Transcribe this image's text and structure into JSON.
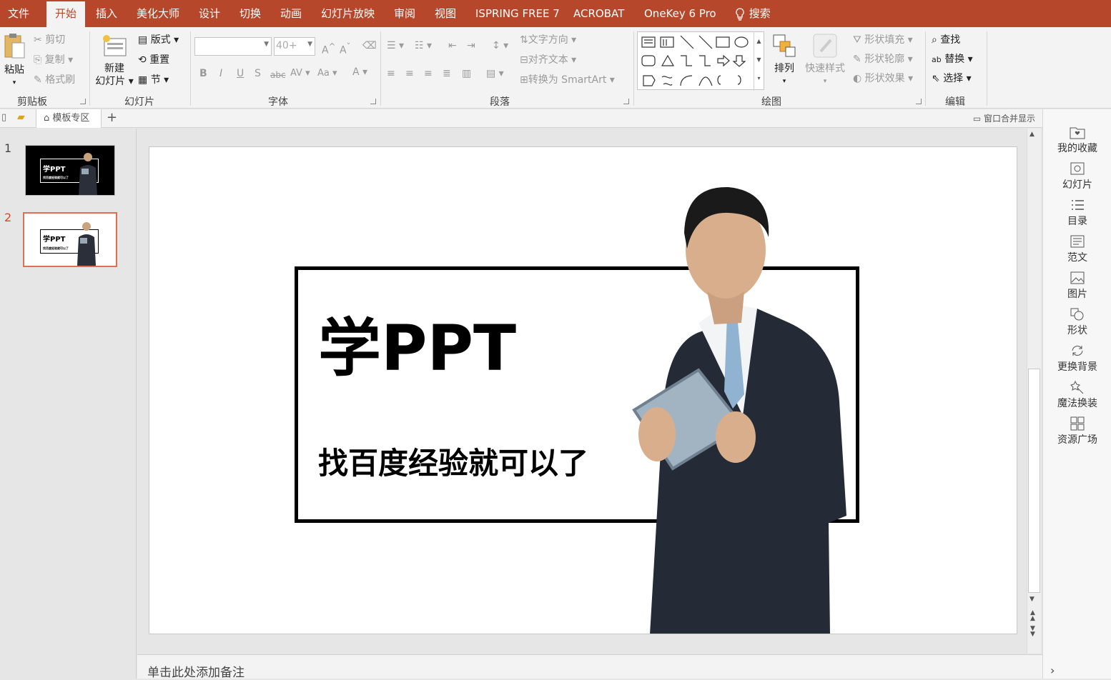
{
  "tabs": [
    "文件",
    "开始",
    "插入",
    "美化大师",
    "设计",
    "切换",
    "动画",
    "幻灯片放映",
    "审阅",
    "视图",
    "ISPRING FREE 7",
    "ACROBAT",
    "OneKey 6 Pro",
    "搜索"
  ],
  "clipboard": {
    "paste": "粘贴",
    "cut": "剪切",
    "copy": "复制",
    "format_painter": "格式刷",
    "group": "剪贴板"
  },
  "slides_group": {
    "new_slide_1": "新建",
    "new_slide_2": "幻灯片",
    "layout": "版式",
    "reset": "重置",
    "section": "节",
    "group": "幻灯片"
  },
  "font": {
    "font_size": "40+",
    "group": "字体",
    "bold": "B",
    "italic": "I",
    "underline": "U",
    "shadow": "S",
    "strike": "abc",
    "spacing": "AV",
    "case": "Aa",
    "color": "A",
    "grow": "A",
    "shrink": "A"
  },
  "paragraph": {
    "text_direction": "文字方向",
    "align_text": "对齐文本",
    "smartart": "转换为 SmartArt",
    "group": "段落"
  },
  "drawing": {
    "arrange": "排列",
    "quick_styles": "快速样式",
    "shape_fill": "形状填充",
    "shape_outline": "形状轮廓",
    "shape_effects": "形状效果",
    "group": "绘图"
  },
  "editing": {
    "find": "查找",
    "replace": "替换",
    "select": "选择",
    "group": "编辑"
  },
  "section_bar": {
    "template_zone": "模板专区",
    "merge_windows": "窗口合并显示"
  },
  "thumbnails": [
    {
      "num": "1",
      "title": "学PPT",
      "subtitle": "找百度经验就可以了"
    },
    {
      "num": "2",
      "title": "学PPT",
      "subtitle": "找百度经验就可以了"
    }
  ],
  "slide": {
    "title": "学PPT",
    "subtitle": "找百度经验就可以了"
  },
  "notes_placeholder": "单击此处添加备注",
  "sidebar": [
    "我的收藏",
    "幻灯片",
    "目录",
    "范文",
    "图片",
    "形状",
    "更换背景",
    "魔法换装",
    "资源广场"
  ],
  "colors": {
    "accent": "#b7472a",
    "selected_thumb": "#e07050"
  }
}
